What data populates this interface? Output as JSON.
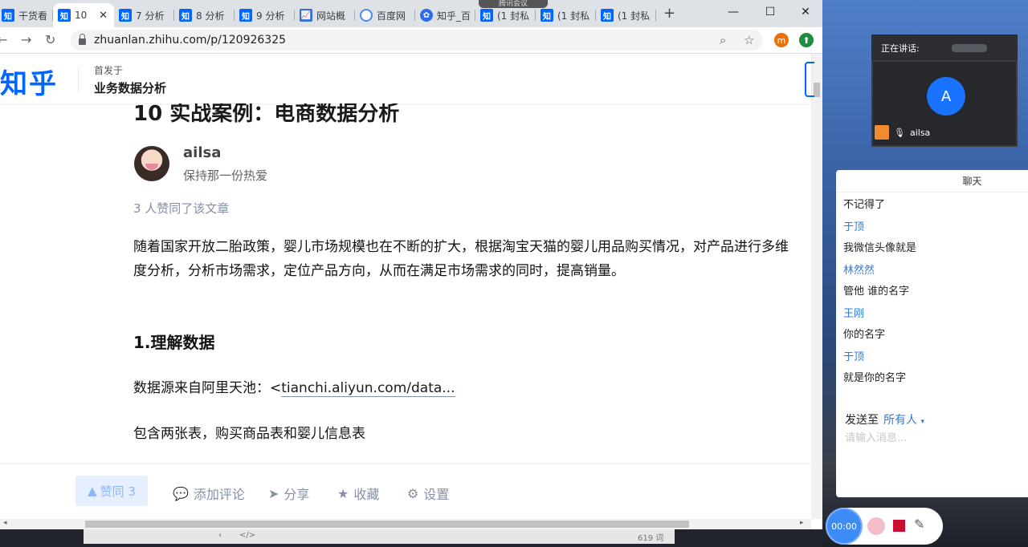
{
  "browser": {
    "tabs": [
      {
        "icon": "知",
        "label": "干货看",
        "active": false
      },
      {
        "icon": "知",
        "label": "10",
        "active": true
      },
      {
        "icon": "知",
        "label": "7 分析",
        "active": false
      },
      {
        "icon": "知",
        "label": "8 分析",
        "active": false
      },
      {
        "icon": "知",
        "label": "9 分析",
        "active": false
      },
      {
        "icon": "chart",
        "label": "网站概",
        "active": false
      },
      {
        "icon": "circ",
        "label": "百度网",
        "active": false
      },
      {
        "icon": "paw",
        "label": "知乎_百",
        "active": false
      },
      {
        "icon": "知",
        "label": "(1 封私",
        "active": false
      },
      {
        "icon": "知",
        "label": "(1 封私",
        "active": false
      },
      {
        "icon": "知",
        "label": "(1 封私",
        "active": false
      }
    ],
    "meeting_indicator": "腾讯会议",
    "url": "zhuanlan.zhihu.com/p/120926325",
    "profile_letter": "m"
  },
  "zhihu": {
    "logo": "知乎",
    "first_published": "首发于",
    "column": "业务数据分析"
  },
  "article": {
    "title": "10 实战案例：电商数据分析",
    "author": "ailsa",
    "bio": "保持那一份热爱",
    "votes_text": "3 人赞同了该文章",
    "intro": "随着国家开放二胎政策，婴儿市场规模也在不断的扩大，根据淘宝天猫的婴儿用品购买情况，对产品进行多维度分析，分析市场需求，定位产品方向，从而在满足市场需求的同时，提高销量。",
    "section1": "1.理解数据",
    "source_prefix": "数据源来自阿里天池：<",
    "source_link": "tianchi.aliyun.com/data...",
    "tables_desc": "包含两张表，购买商品表和婴儿信息表"
  },
  "actions": {
    "vote": "赞同 3",
    "comment": "添加评论",
    "share": "分享",
    "favorite": "收藏",
    "settings": "设置"
  },
  "statusbar": {
    "word_count": "619 词"
  },
  "meeting": {
    "speaking_label": "正在讲话:",
    "participant_initial": "A",
    "participant_name": "ailsa"
  },
  "chat": {
    "title": "聊天",
    "messages": [
      {
        "text": "不记得了",
        "type": "text"
      },
      {
        "text": "于顶",
        "type": "name"
      },
      {
        "text": "我微信头像就是",
        "type": "text"
      },
      {
        "text": "林然然",
        "type": "name"
      },
      {
        "text": "管他 谁的名字",
        "type": "text"
      },
      {
        "text": "王刚",
        "type": "name"
      },
      {
        "text": "你的名字",
        "type": "text"
      },
      {
        "text": "于顶",
        "type": "name"
      },
      {
        "text": "就是你的名字",
        "type": "text"
      }
    ],
    "send_to_label": "发送至",
    "send_to_target": "所有人",
    "input_placeholder": "请输入消息..."
  },
  "recorder": {
    "timer": "00:00"
  }
}
